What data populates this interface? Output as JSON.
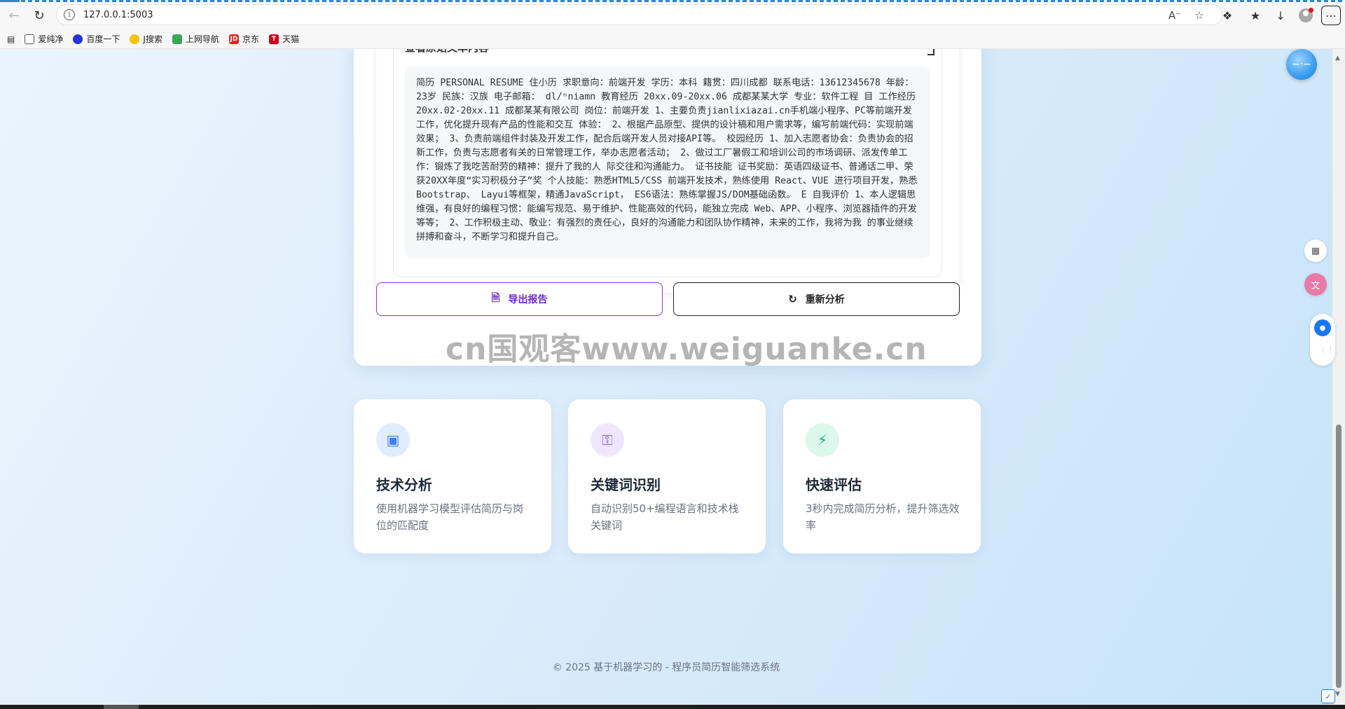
{
  "browser": {
    "url": "127.0.0.1:5003",
    "bookmarks": [
      {
        "label": "爱纯净",
        "icon": "folder-icon"
      },
      {
        "label": "百度一下",
        "icon": "baidu-icon"
      },
      {
        "label": "J搜索",
        "icon": "jsearch-icon"
      },
      {
        "label": "上网导航",
        "icon": "nav-icon"
      },
      {
        "label": "京东",
        "icon": "jd-icon",
        "icon_text": "JD",
        "color": "#e1251b"
      },
      {
        "label": "天猫",
        "icon": "tmall-icon",
        "icon_text": "T",
        "color": "#d4001a"
      }
    ]
  },
  "resume_card": {
    "details_title": "查看原始文本内容",
    "raw_text": "简历 PERSONAL RESUME 住小历 求职意向：前端开发 学历：本科 籍贯：四川成都 联系电话：13612345678 年龄：23岁 民族：汉族 电子邮箱： dl/ⁿniamn 教育经历 20xx.09-20xx.06 成都某某大学 专业：软件工程 目 工作经历 20xx.02-20xx.11 成都某某有限公司 岗位：前端开发 1、主要负责jianlixiazai.cn手机端小程序、PC等前端开发工作，优化提升现有产品的性能和交互 体验： 2、根据产品原型、提供的设计稿和用户需求等，编写前端代码：实现前端效果； 3、负责前端组件封装及开发工作，配合后端开发人员对接API等。 校园经历 1、加入志愿者协会：负责协会的招新工作，负责与志愿者有关的日常管理工作，举办志愿者活动； 2、做过工厂暑假工和培训公司的市场调研、派发传单工作：锻炼了我吃苦耐劳的精神：提升了我的人 际交往和沟通能力。 证书技能 证书奖励：英语四级证书、普通话二甲、荣获20XX年度“实习积极分子”奖 个人技能：熟悉HTML5/CSS 前端开发技术，熟练使用 React、VUE 进行项目开发，熟悉Bootstrap、 Layui等框架，精通JavaScript， ES6语法：熟练掌握JS/DOM基础函数。 E 自我评价 1、本人逻辑思维强，有良好的编程习惯：能编写规范、易于维护、性能高效的代码，能独立完成 Web、APP、小程序、浏览器插件的开发等等； 2、工作积极主动、敬业：有强烈的责任心，良好的沟通能力和团队协作精神，未来的工作，我将为我 的事业继续拼搏和奋斗，不断学习和提升自己。",
    "export_label": "导出报告",
    "reanalyze_label": "重新分析"
  },
  "watermark": "cn国观客www.weiguanke.cn",
  "features": [
    {
      "title": "技术分析",
      "desc": "使用机器学习模型评估简历与岗位的匹配度",
      "icon": "robot-icon",
      "color": "#3b82f6",
      "bg": "#e0edff"
    },
    {
      "title": "关键词识别",
      "desc": "自动识别50+编程语言和技术栈关键词",
      "icon": "key-icon",
      "color": "#8b5cf6",
      "bg": "#efe7ff"
    },
    {
      "title": "快速评估",
      "desc": "3秒内完成简历分析，提升筛选效率",
      "icon": "bolt-icon",
      "color": "#10b981",
      "bg": "#dcf7ec"
    }
  ],
  "footer": "© 2025 基于机器学习的 - 程序员简历智能筛选系统",
  "colors": {
    "accent": "#7c3aed",
    "page_bg": "#dcecfb"
  }
}
